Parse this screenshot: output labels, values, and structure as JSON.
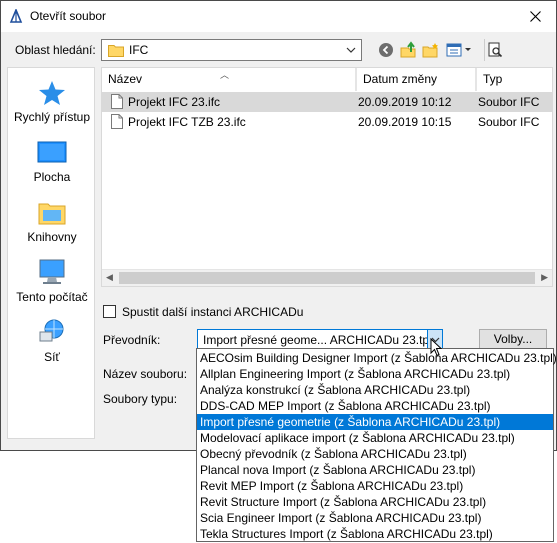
{
  "window": {
    "title": "Otevřít soubor"
  },
  "lookin": {
    "label": "Oblast hledání:",
    "value": "IFC"
  },
  "toolbar": {
    "icons": [
      "back-icon",
      "up-folder-icon",
      "new-folder-icon",
      "view-menu-icon",
      "preview-icon"
    ]
  },
  "places": [
    {
      "label": "Rychlý přístup",
      "icon": "star-icon"
    },
    {
      "label": "Plocha",
      "icon": "desktop-icon"
    },
    {
      "label": "Knihovny",
      "icon": "libraries-icon"
    },
    {
      "label": "Tento počítač",
      "icon": "computer-icon"
    },
    {
      "label": "Síť",
      "icon": "network-icon"
    }
  ],
  "columns": {
    "name": "Název",
    "date": "Datum změny",
    "type": "Typ"
  },
  "files": [
    {
      "name": "Projekt IFC 23.ifc",
      "date": "20.09.2019 10:12",
      "type": "Soubor IFC",
      "selected": true
    },
    {
      "name": "Projekt IFC TZB 23.ifc",
      "date": "20.09.2019 10:15",
      "type": "Soubor IFC",
      "selected": false
    }
  ],
  "checkbox": {
    "label": "Spustit další instanci ARCHICADu",
    "checked": false
  },
  "converter": {
    "label": "Převodník:",
    "value": "Import přesné geome... ARCHICADu 23.tpl)",
    "options_button": "Volby...",
    "options": [
      "AECOsim Building Designer Import (z Šablona ARCHICADu 23.tpl)",
      "Allplan Engineering Import (z Šablona ARCHICADu 23.tpl)",
      "Analýza konstrukcí (z Šablona ARCHICADu 23.tpl)",
      "DDS-CAD MEP Import (z Šablona ARCHICADu 23.tpl)",
      "Import přesné geometrie (z Šablona ARCHICADu 23.tpl)",
      "Modelovací aplikace import (z Šablona ARCHICADu 23.tpl)",
      "Obecný převodník (z Šablona ARCHICADu 23.tpl)",
      "Plancal nova Import (z Šablona ARCHICADu 23.tpl)",
      "Revit MEP Import (z Šablona ARCHICADu 23.tpl)",
      "Revit Structure Import (z Šablona ARCHICADu 23.tpl)",
      "Scia Engineer Import (z Šablona ARCHICADu 23.tpl)",
      "Tekla Structures Import (z Šablona ARCHICADu 23.tpl)"
    ],
    "selected_index": 4
  },
  "filename": {
    "label": "Název souboru:"
  },
  "filetype": {
    "label": "Soubory typu:"
  },
  "colors": {
    "accent": "#0078d7",
    "selection": "#d9d9d9"
  }
}
